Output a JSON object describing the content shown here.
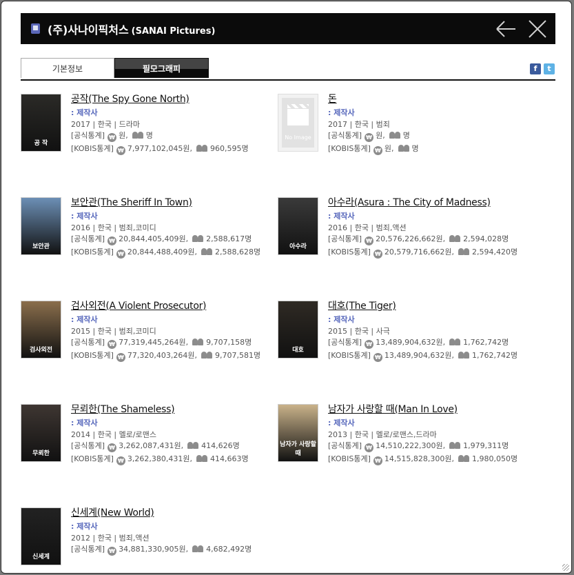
{
  "header": {
    "title": "(주)사나이픽처스",
    "title_en": "(SANAI Pictures)"
  },
  "tabs": [
    {
      "label": "기본정보",
      "active": false
    },
    {
      "label": "필모그래피",
      "active": true
    }
  ],
  "social": {
    "facebook": "f",
    "twitter": "t"
  },
  "stat_labels": {
    "official": "[공식통계]",
    "kobis": "[KOBIS통계]"
  },
  "films": [
    {
      "title": "공작(The Spy Gone North)",
      "role": ": 제작사",
      "meta": "2017 | 한국 | 드라마",
      "poster_text": "공 작",
      "poster_color": "#2b2a27",
      "official": {
        "revenue": "원,",
        "audience": "명"
      },
      "kobis": {
        "revenue": "7,977,102,045원,",
        "audience": "960,595명"
      }
    },
    {
      "title": "돈",
      "role": ": 제작사",
      "meta": "2017 | 한국 | 범죄",
      "poster_text": "No Image",
      "no_image": true,
      "official": {
        "revenue": "원,",
        "audience": "명"
      },
      "kobis": {
        "revenue": "원,",
        "audience": "명"
      }
    },
    {
      "title": "보안관(The Sheriff In Town)",
      "role": ": 제작사",
      "meta": "2016 | 한국 | 범죄,코미디",
      "poster_text": "보안관",
      "poster_color": "#6c8fb5",
      "official": {
        "revenue": "20,844,405,409원,",
        "audience": "2,588,617명"
      },
      "kobis": {
        "revenue": "20,844,488,409원,",
        "audience": "2,588,628명"
      }
    },
    {
      "title": "아수라(Asura : The City of Madness)",
      "role": ": 제작사",
      "meta": "2016 | 한국 | 범죄,액션",
      "poster_text": "아수라",
      "poster_color": "#3a3a3a",
      "official": {
        "revenue": "20,576,226,662원,",
        "audience": "2,594,028명"
      },
      "kobis": {
        "revenue": "20,579,716,662원,",
        "audience": "2,594,420명"
      }
    },
    {
      "title": "검사외전(A Violent Prosecutor)",
      "role": ": 제작사",
      "meta": "2015 | 한국 | 범죄,코미디",
      "poster_text": "검사외전",
      "poster_color": "#8a6e4c",
      "official": {
        "revenue": "77,319,445,264원,",
        "audience": "9,707,158명"
      },
      "kobis": {
        "revenue": "77,320,403,264원,",
        "audience": "9,707,581명"
      }
    },
    {
      "title": "대호(The Tiger)",
      "role": ": 제작사",
      "meta": "2015 | 한국 | 사극",
      "poster_text": "대호",
      "poster_color": "#2f2a24",
      "official": {
        "revenue": "13,489,904,632원,",
        "audience": "1,762,742명"
      },
      "kobis": {
        "revenue": "13,489,904,632원,",
        "audience": "1,762,742명"
      }
    },
    {
      "title": "무뢰한(The Shameless)",
      "role": ": 제작사",
      "meta": "2014 | 한국 | 멜로/로맨스",
      "poster_text": "무뢰한",
      "poster_color": "#3e3632",
      "official": {
        "revenue": "3,262,087,431원,",
        "audience": "414,626명"
      },
      "kobis": {
        "revenue": "3,262,380,431원,",
        "audience": "414,663명"
      }
    },
    {
      "title": "남자가 사랑할 때(Man In Love)",
      "role": ": 제작사",
      "meta": "2013 | 한국 | 멜로/로맨스,드라마",
      "poster_text": "남자가 사랑할 때",
      "poster_color": "#c9b28a",
      "official": {
        "revenue": "14,510,222,300원,",
        "audience": "1,979,311명"
      },
      "kobis": {
        "revenue": "14,515,828,300원,",
        "audience": "1,980,050명"
      }
    },
    {
      "title": "신세계(New World)",
      "role": ": 제작사",
      "meta": "2012 | 한국 | 범죄,액션",
      "poster_text": "신세계",
      "poster_color": "#222222",
      "official": {
        "revenue": "34,881,330,905원,",
        "audience": "4,682,492명"
      }
    }
  ]
}
